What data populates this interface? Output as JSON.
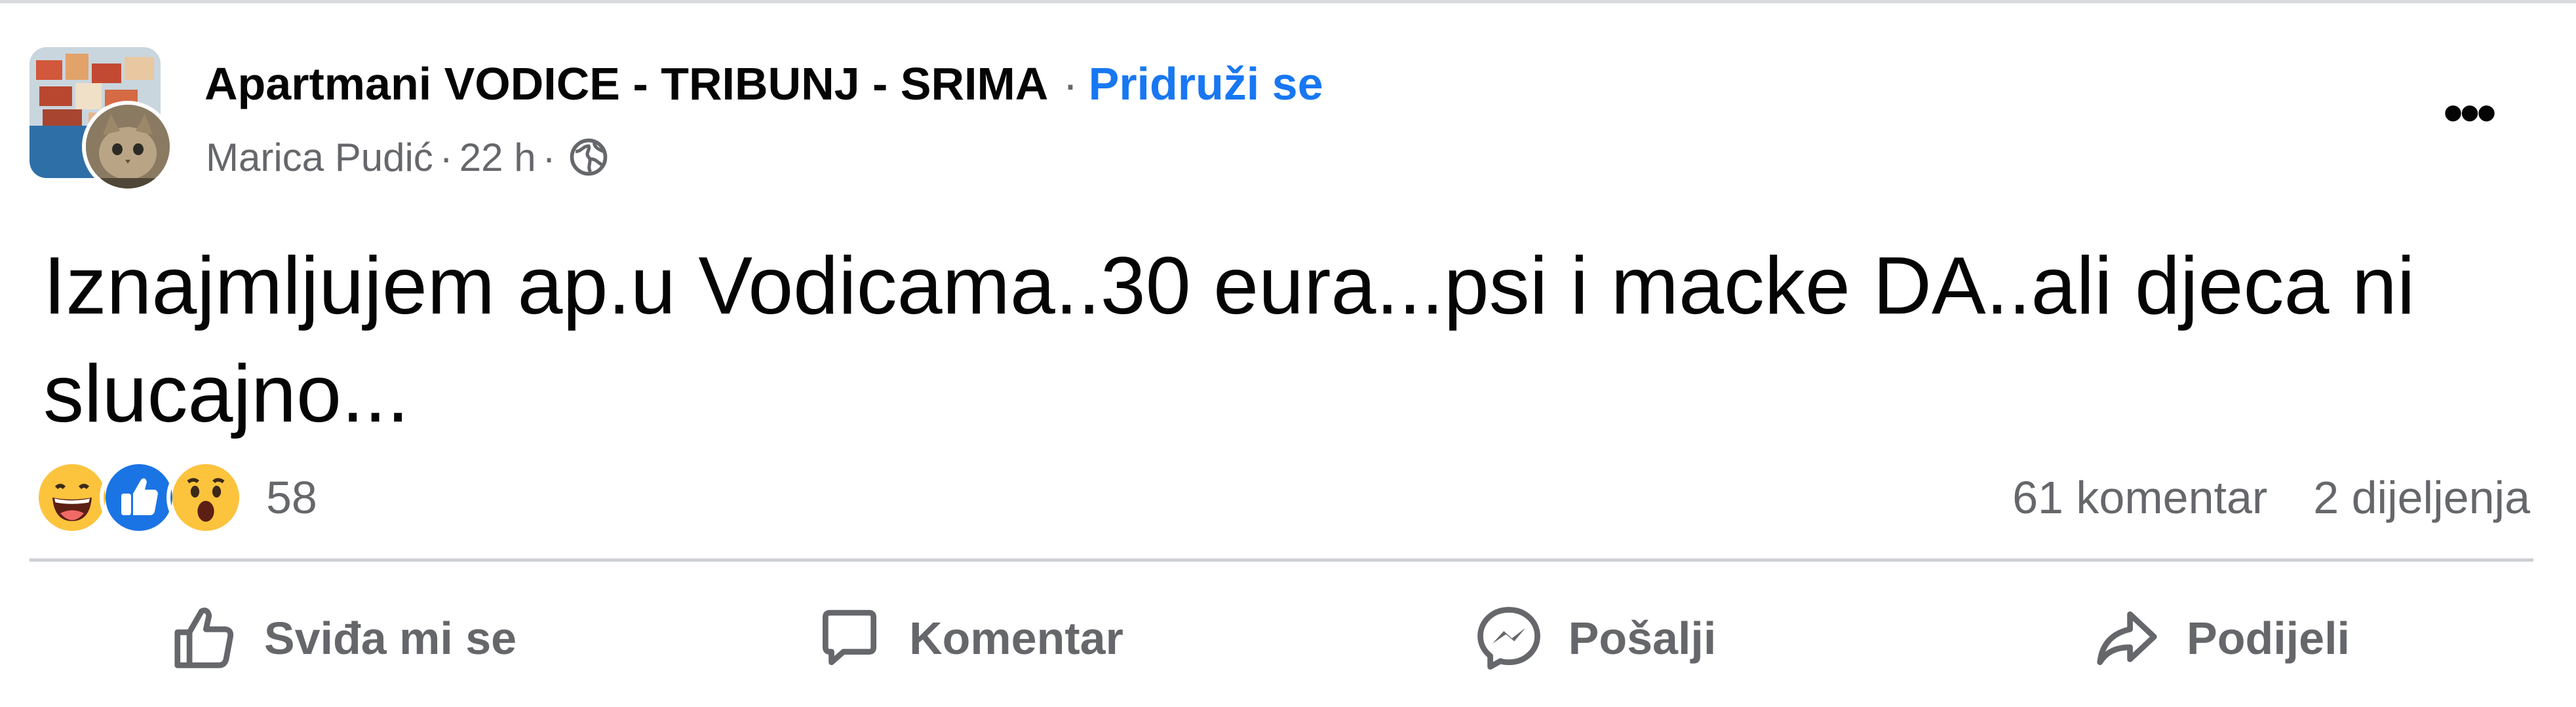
{
  "post": {
    "group_name": "Apartmani VODICE - TRIBUNJ - SRIMA",
    "separator": "·",
    "join_label": "Pridruži se",
    "author": "Marica Pudić",
    "time": "22 h",
    "privacy_icon": "globe-icon",
    "more_label": "•••",
    "text": "Iznajmljujem ap.u Vodicama..30 eura...psi i macke DA..ali djeca ni slucajno...",
    "reactions": {
      "icons": [
        "haha-icon",
        "like-icon",
        "wow-icon"
      ],
      "count": "58"
    },
    "comments": "61 komentar",
    "shares": "2 dijeljenja"
  },
  "actions": [
    {
      "label": "Sviđa mi se",
      "icon": "thumbs-up-icon"
    },
    {
      "label": "Komentar",
      "icon": "comment-icon"
    },
    {
      "label": "Pošalji",
      "icon": "messenger-icon"
    },
    {
      "label": "Podijeli",
      "icon": "share-arrow-icon"
    }
  ],
  "colors": {
    "accent": "#1877f2",
    "secondary_text": "#65676b",
    "primary_text": "#050505",
    "divider": "#ced0d4"
  }
}
